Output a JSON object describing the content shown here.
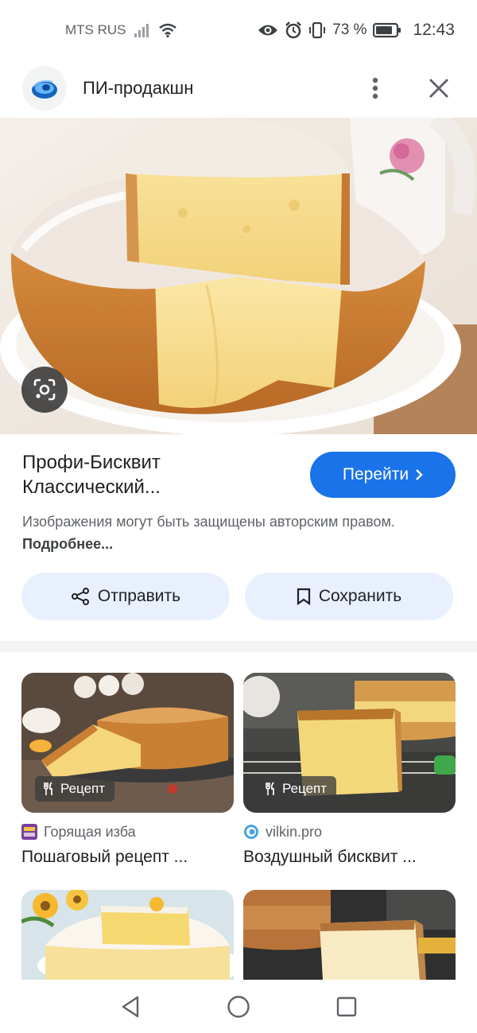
{
  "status_bar": {
    "carrier": "MTS RUS",
    "battery_percent": "73 %",
    "time": "12:43"
  },
  "header": {
    "site_name": "ПИ-продакшн",
    "logo_icon": "site-logo-icon",
    "more_icon": "more-vert-icon",
    "close_icon": "close-icon"
  },
  "hero": {
    "lens_icon": "google-lens-icon"
  },
  "result": {
    "title": "Профи-Бисквит Классический...",
    "visit_label": "Перейти",
    "copyright_text": "Изображения могут быть защищены авторским правом.",
    "more_link": "Подробнее..."
  },
  "actions": {
    "share_label": "Отправить",
    "save_label": "Сохранить"
  },
  "related": [
    {
      "badge": "Рецепт",
      "source": "Горящая изба",
      "title": "Пошаговый рецепт ..."
    },
    {
      "badge": "Рецепт",
      "source": "vilkin.pro",
      "title": "Воздушный бисквит ..."
    },
    {
      "badge": "",
      "source": "",
      "title": ""
    },
    {
      "badge": "",
      "source": "",
      "title": ""
    }
  ],
  "colors": {
    "accent": "#1a73e8",
    "chip_bg": "#e8f0fe"
  }
}
